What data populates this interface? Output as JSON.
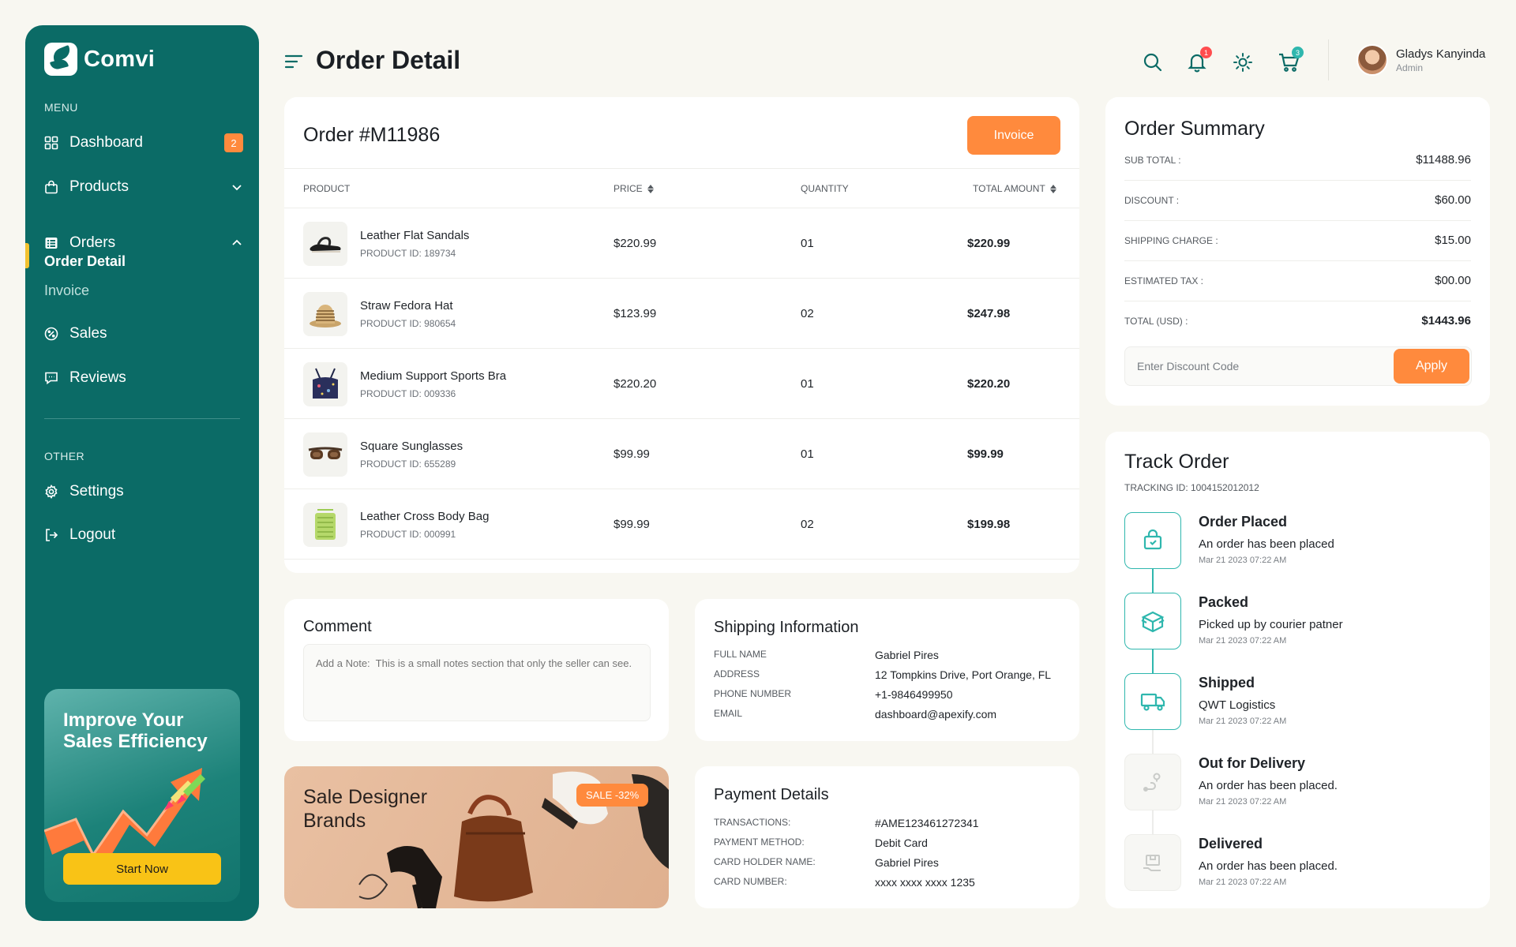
{
  "brand": {
    "name": "Comvi"
  },
  "sidebar": {
    "menu_label": "MENU",
    "other_label": "OTHER",
    "items": [
      {
        "label": "Dashboard",
        "icon": "grid-icon",
        "badge": "2"
      },
      {
        "label": "Products",
        "icon": "bag-icon"
      },
      {
        "label": "Orders",
        "icon": "orders-icon"
      },
      {
        "label": "Sales",
        "icon": "percent-icon"
      },
      {
        "label": "Reviews",
        "icon": "chat-icon"
      }
    ],
    "orders_sub": [
      {
        "label": "Order Detail"
      },
      {
        "label": "Invoice"
      }
    ],
    "other_items": [
      {
        "label": "Settings",
        "icon": "gear-icon"
      },
      {
        "label": "Logout",
        "icon": "logout-icon"
      }
    ],
    "promo": {
      "title_line1": "Improve Your",
      "title_line2": "Sales Efficiency",
      "button": "Start Now"
    }
  },
  "header": {
    "title": "Order Detail",
    "notification_count": "1",
    "cart_count": "3",
    "user": {
      "name": "Gladys Kanyinda",
      "role": "Admin"
    }
  },
  "order": {
    "title": "Order #M11986",
    "invoice_button": "Invoice",
    "columns": {
      "product": "PRODUCT",
      "price": "PRICE",
      "quantity": "QUANTITY",
      "total": "TOTAL AMOUNT"
    },
    "rows": [
      {
        "name": "Leather Flat Sandals",
        "pid": "PRODUCT ID: 189734",
        "price": "$220.99",
        "qty": "01",
        "total": "$220.99"
      },
      {
        "name": "Straw Fedora Hat",
        "pid": "PRODUCT ID: 980654",
        "price": "$123.99",
        "qty": "02",
        "total": "$247.98"
      },
      {
        "name": "Medium Support Sports Bra",
        "pid": "PRODUCT ID: 009336",
        "price": "$220.20",
        "qty": "01",
        "total": "$220.20"
      },
      {
        "name": "Square Sunglasses",
        "pid": "PRODUCT ID: 655289",
        "price": "$99.99",
        "qty": "01",
        "total": "$99.99"
      },
      {
        "name": "Leather Cross Body Bag",
        "pid": "PRODUCT ID: 000991",
        "price": "$99.99",
        "qty": "02",
        "total": "$199.98"
      }
    ]
  },
  "comment": {
    "title": "Comment",
    "placeholder": "Add a Note:  This is a small notes section that only the seller can see."
  },
  "shipping": {
    "title": "Shipping Information",
    "full_name_label": "FULL NAME",
    "full_name": "Gabriel Pires",
    "address_label": "ADDRESS",
    "address": "12 Tompkins Drive, Port Orange, FL",
    "phone_label": "PHONE NUMBER",
    "phone": "+1-9846499950",
    "email_label": "EMAIL",
    "email": "dashboard@apexify.com"
  },
  "banner": {
    "title_line1": "Sale Designer",
    "title_line2": "Brands",
    "tag": "SALE -32%"
  },
  "payment": {
    "title": "Payment Details",
    "transactions_label": "TRANSACTIONS:",
    "transactions": "#AME123461272341",
    "method_label": "PAYMENT METHOD:",
    "method": "Debit Card",
    "holder_label": "CARD HOLDER NAME:",
    "holder": "Gabriel Pires",
    "card_label": "CARD NUMBER:",
    "card": "xxxx xxxx xxxx 1235"
  },
  "summary": {
    "title": "Order Summary",
    "subtotal_label": "SUB TOTAL :",
    "subtotal": "$11488.96",
    "discount_label": "DISCOUNT :",
    "discount": "$60.00",
    "shipping_label": "SHIPPING CHARGE :",
    "shipping": "$15.00",
    "tax_label": "ESTIMATED TAX :",
    "tax": "$00.00",
    "total_label": "TOTAL (USD) :",
    "total": "$1443.96",
    "discount_placeholder": "Enter Discount Code",
    "apply_button": "Apply"
  },
  "track": {
    "title": "Track Order",
    "tracking_id": "TRACKING ID: 1004152012012",
    "steps": [
      {
        "title": "Order Placed",
        "desc": "An order has been placed",
        "time": "Mar 21 2023 07:22 AM",
        "done": true
      },
      {
        "title": "Packed",
        "desc": "Picked up by courier patner",
        "time": "Mar 21 2023 07:22 AM",
        "done": true
      },
      {
        "title": "Shipped",
        "desc": "QWT Logistics",
        "time": "Mar 21 2023 07:22 AM",
        "done": true
      },
      {
        "title": "Out for Delivery",
        "desc": "An order has been placed.",
        "time": "Mar 21 2023 07:22 AM",
        "done": false
      },
      {
        "title": "Delivered",
        "desc": "An order has been placed.",
        "time": "Mar 21 2023 07:22 AM",
        "done": false
      }
    ]
  },
  "colors": {
    "primary": "#0b6b66",
    "accent": "#ff8a3d",
    "teal": "#2fb7ae",
    "highlight": "#f9c316"
  }
}
